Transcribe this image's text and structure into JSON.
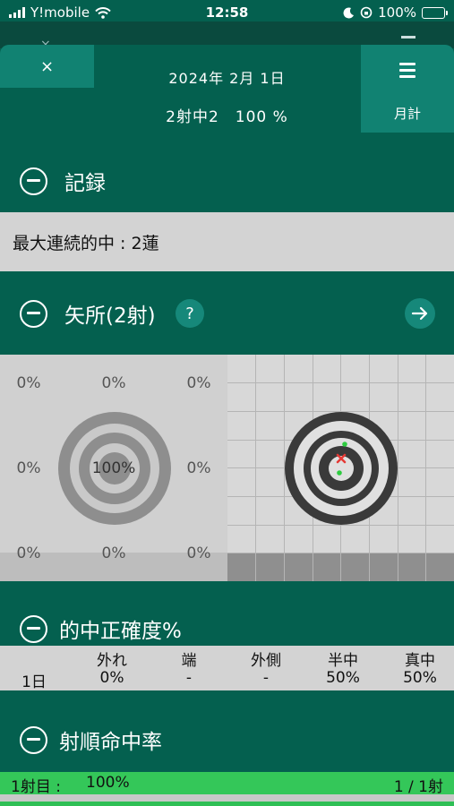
{
  "status_bar": {
    "carrier": "Y!mobile",
    "time": "12:58",
    "battery": "100%"
  },
  "header": {
    "close_label": "×",
    "date": "2024年 2月 1日",
    "summary": "2射中2　100 %",
    "month_label": "月計"
  },
  "sections": {
    "record": {
      "title": "記録",
      "max_streak": "最大連続的中 : 2蓮"
    },
    "arrow_position": {
      "title": "矢所(2射)",
      "help_label": "?",
      "zones": [
        "0%",
        "0%",
        "0%",
        "0%",
        "100%",
        "0%",
        "0%",
        "0%",
        "0%"
      ]
    },
    "accuracy": {
      "title": "的中正確度%",
      "headers": [
        "外れ",
        "端",
        "外側",
        "半中",
        "真中"
      ],
      "row_label": "1日",
      "values": [
        "0%",
        "-",
        "-",
        "50%",
        "50%"
      ]
    },
    "shot_order": {
      "title": "射順命中率",
      "row": {
        "label": "1射目 :",
        "rate": "100%",
        "count": "1 / 1射",
        "fill": 1.0
      }
    }
  },
  "colors": {
    "background": "#04604f",
    "button": "#118272",
    "panel": "#d3d3d3",
    "hit_bar": "#34c759",
    "miss_mark": "#e53935",
    "hit_mark": "#2ecc40"
  },
  "icons": [
    "signal-icon",
    "wifi-icon",
    "moon-icon",
    "lock-rotation-icon",
    "battery-icon",
    "menu-icon",
    "minus-circle-icon",
    "help-icon",
    "arrow-right-icon"
  ]
}
